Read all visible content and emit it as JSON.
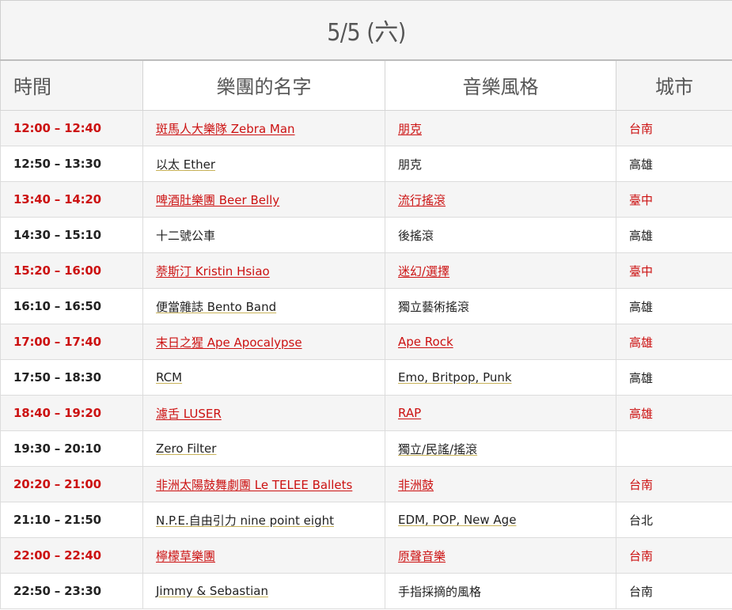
{
  "date_title": "5/5 (六)",
  "headers": {
    "time": "時間",
    "band": "樂團的名字",
    "genre": "音樂風格",
    "city": "城市"
  },
  "rows": [
    {
      "time": "12:00 – 12:40",
      "band": "斑馬人大樂隊 Zebra Man",
      "band_link": true,
      "genre": "朋克",
      "genre_link": true,
      "city": "台南"
    },
    {
      "time": "12:50 – 13:30",
      "band": "以太 Ether",
      "band_link": true,
      "genre": "朋克",
      "genre_link": false,
      "city": "高雄"
    },
    {
      "time": "13:40 – 14:20",
      "band": "啤酒肚樂團 Beer Belly",
      "band_link": true,
      "genre": "流行搖滾",
      "genre_link": true,
      "city": "臺中"
    },
    {
      "time": "14:30 – 15:10",
      "band": "十二號公車",
      "band_link": false,
      "genre": "後搖滾",
      "genre_link": false,
      "city": "高雄"
    },
    {
      "time": "15:20 – 16:00",
      "band": "萘斯汀 Kristin Hsiao",
      "band_link": true,
      "genre": "迷幻/選擇",
      "genre_link": true,
      "city": "臺中"
    },
    {
      "time": "16:10 – 16:50",
      "band": "便當雜誌 Bento Band",
      "band_link": true,
      "genre": "獨立藝術搖滾",
      "genre_link": false,
      "city": "高雄"
    },
    {
      "time": "17:00 – 17:40",
      "band": "末日之猩 Ape Apocalypse",
      "band_link": true,
      "genre": "Ape Rock",
      "genre_link": true,
      "city": "高雄"
    },
    {
      "time": "17:50 – 18:30",
      "band": "RCM",
      "band_link": true,
      "genre": "Emo, Britpop, Punk",
      "genre_link": true,
      "city": "高雄"
    },
    {
      "time": "18:40 – 19:20",
      "band": "濾舌 LUSER",
      "band_link": true,
      "genre": "RAP",
      "genre_link": true,
      "city": "高雄"
    },
    {
      "time": "19:30 – 20:10",
      "band": "Zero Filter",
      "band_link": true,
      "genre": "獨立/民謠/搖滾",
      "genre_link": true,
      "city": ""
    },
    {
      "time": "20:20 – 21:00",
      "band": "非洲太陽鼓舞劇團 Le TELEE Ballets",
      "band_link": true,
      "genre": "非洲鼓",
      "genre_link": true,
      "city": "台南"
    },
    {
      "time": "21:10 – 21:50",
      "band": "N.P.E.自由引力 nine point eight",
      "band_link": true,
      "genre": "EDM, POP, New Age",
      "genre_link": true,
      "city": "台北"
    },
    {
      "time": "22:00 – 22:40",
      "band": "檸檬草樂團",
      "band_link": true,
      "genre": "原聲音樂",
      "genre_link": true,
      "city": "台南"
    },
    {
      "time": "22:50 – 23:30",
      "band": "Jimmy & Sebastian",
      "band_link": true,
      "genre": "手指採摘的風格",
      "genre_link": false,
      "city": "台南"
    }
  ],
  "colors": {
    "highlight_text": "#cc1111",
    "normal_text": "#222222",
    "stripe_bg": "#f5f5f5"
  }
}
